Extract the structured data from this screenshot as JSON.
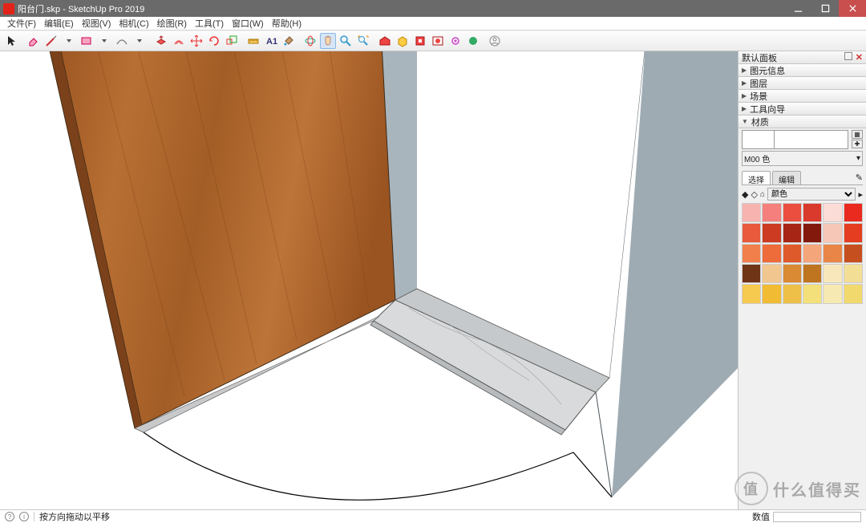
{
  "window": {
    "title": "阳台门.skp - SketchUp Pro 2019"
  },
  "menu": [
    "文件(F)",
    "编辑(E)",
    "视图(V)",
    "相机(C)",
    "绘图(R)",
    "工具(T)",
    "窗口(W)",
    "帮助(H)"
  ],
  "status": {
    "hint": "按方向拖动以平移",
    "measure_label": "数值"
  },
  "panels": {
    "header": "默认面板",
    "sections": [
      "图元信息",
      "图层",
      "场景",
      "工具向导",
      "材质"
    ],
    "material_name": "M00 色",
    "tabs": {
      "select": "选择",
      "edit": "编辑"
    },
    "palette_label": "颜色",
    "swatches": [
      "#f7b3b0",
      "#f47f7c",
      "#eb4e3e",
      "#d93a2b",
      "#fbdcd6",
      "#ea2a1f",
      "#e85a3b",
      "#cc3b22",
      "#a72515",
      "#83180c",
      "#f6c7b6",
      "#e43d20",
      "#f07f4b",
      "#ee6b3a",
      "#df5a2a",
      "#f5a57a",
      "#e98647",
      "#c64f1f",
      "#6f3416",
      "#f1c78f",
      "#d98a33",
      "#bf7420",
      "#f8e7bb",
      "#f3de96",
      "#f6c94f",
      "#f1bb33",
      "#eec048",
      "#f3e07a",
      "#f6e9b2",
      "#f2d96e"
    ]
  },
  "watermark": "什么值得买"
}
